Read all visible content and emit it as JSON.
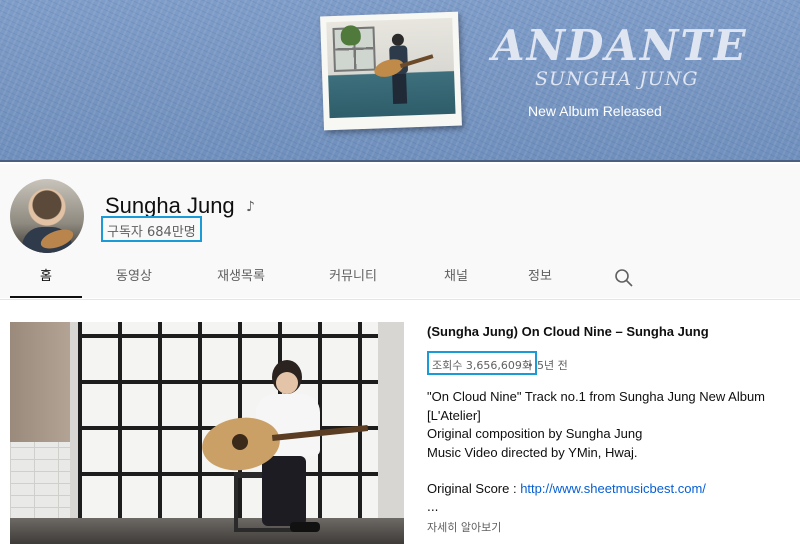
{
  "banner": {
    "album_title": "ANDANTE",
    "album_artist": "SUNGHA JUNG",
    "album_subtitle": "New Album Released"
  },
  "channel": {
    "name": "Sungha Jung",
    "badge_icon": "music-note-icon",
    "subscribers": "구독자 684만명"
  },
  "tabs": [
    {
      "label": "홈",
      "active": true
    },
    {
      "label": "동영상"
    },
    {
      "label": "재생목록"
    },
    {
      "label": "커뮤니티"
    },
    {
      "label": "채널"
    },
    {
      "label": "정보"
    }
  ],
  "search_icon": "search-icon",
  "featured": {
    "title": "(Sungha Jung) On Cloud Nine – Sungha Jung",
    "views": "조회수 3,656,609회",
    "separator": "•",
    "age": "5년 전",
    "description": [
      "\"On Cloud Nine\" Track no.1 from Sungha Jung New Album",
      "[L'Atelier]",
      "Original composition by Sungha Jung",
      "Music Video directed by YMin, Hwaj."
    ],
    "score_label": "Original Score : ",
    "score_link": "http://www.sheetmusicbest.com/",
    "ellipsis": "...",
    "more_label": "자세히 알아보기"
  },
  "colors": {
    "highlight_box": "#1a9ad6",
    "link": "#065fd4",
    "banner_blue": "#7896c2"
  }
}
